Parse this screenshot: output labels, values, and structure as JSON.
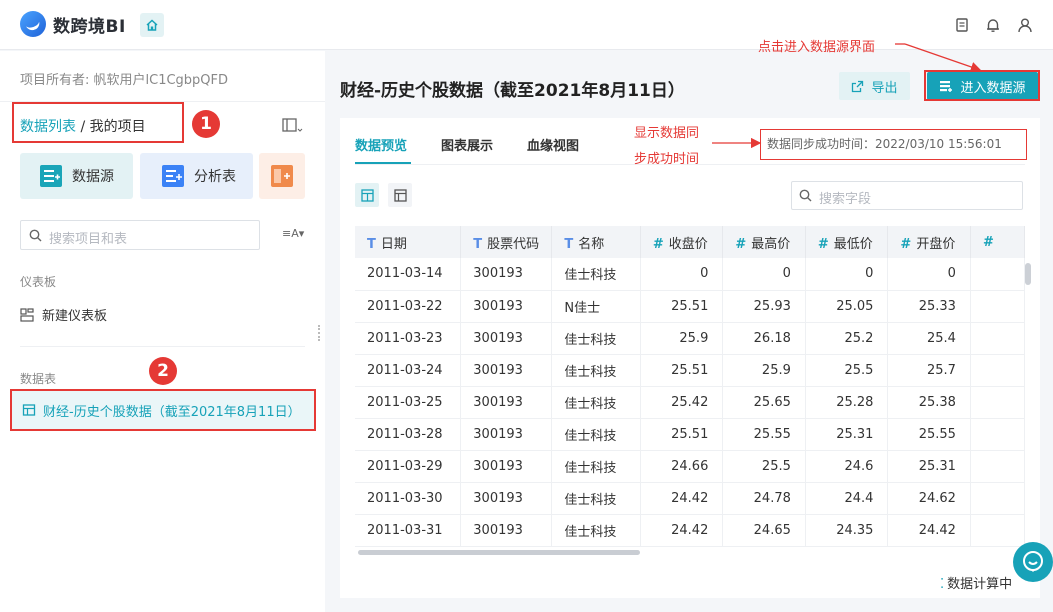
{
  "app": {
    "name": "数跨境BI"
  },
  "sidebar": {
    "owner_label": "项目所有者: 帆软用户lC1CgbpQFD",
    "breadcrumb_link": "数据列表",
    "breadcrumb_sep": " / ",
    "breadcrumb_current": "我的项目",
    "quick_actions": [
      {
        "label": "数据源",
        "icon": "datasource-icon"
      },
      {
        "label": "分析表",
        "icon": "analysis-table-icon"
      }
    ],
    "search_placeholder": "搜索项目和表",
    "dashboard_section": "仪表板",
    "new_dashboard": "新建仪表板",
    "table_section": "数据表",
    "selected_table": "财经-历史个股数据（截至2021年8月11日）"
  },
  "main": {
    "title": "财经-历史个股数据（截至2021年8月11日）",
    "export_label": "导出",
    "enter_label": "进入数据源",
    "tabs": [
      {
        "label": "数据预览",
        "active": true
      },
      {
        "label": "图表展示",
        "active": false
      },
      {
        "label": "血缘视图",
        "active": false
      }
    ],
    "sync_text": "数据同步成功时间：2022/03/10 15:56:01",
    "field_search_placeholder": "搜索字段",
    "computing_label": "数据计算中"
  },
  "table": {
    "columns": [
      {
        "type": "T",
        "label": "日期"
      },
      {
        "type": "T",
        "label": "股票代码"
      },
      {
        "type": "T",
        "label": "名称"
      },
      {
        "type": "#",
        "label": "收盘价"
      },
      {
        "type": "#",
        "label": "最高价"
      },
      {
        "type": "#",
        "label": "最低价"
      },
      {
        "type": "#",
        "label": "开盘价"
      },
      {
        "type": "#",
        "label": ""
      }
    ],
    "rows": [
      [
        "2011-03-14",
        "300193",
        "佳士科技",
        "0",
        "0",
        "0",
        "0"
      ],
      [
        "2011-03-22",
        "300193",
        "N佳士",
        "25.51",
        "25.93",
        "25.05",
        "25.33"
      ],
      [
        "2011-03-23",
        "300193",
        "佳士科技",
        "25.9",
        "26.18",
        "25.2",
        "25.4"
      ],
      [
        "2011-03-24",
        "300193",
        "佳士科技",
        "25.51",
        "25.9",
        "25.5",
        "25.7"
      ],
      [
        "2011-03-25",
        "300193",
        "佳士科技",
        "25.42",
        "25.65",
        "25.28",
        "25.38"
      ],
      [
        "2011-03-28",
        "300193",
        "佳士科技",
        "25.51",
        "25.55",
        "25.31",
        "25.55"
      ],
      [
        "2011-03-29",
        "300193",
        "佳士科技",
        "24.66",
        "25.5",
        "24.6",
        "25.31"
      ],
      [
        "2011-03-30",
        "300193",
        "佳士科技",
        "24.42",
        "24.78",
        "24.4",
        "24.62"
      ],
      [
        "2011-03-31",
        "300193",
        "佳士科技",
        "24.42",
        "24.65",
        "24.35",
        "24.42"
      ]
    ]
  },
  "annotations": {
    "enter_hint": "点击进入数据源界面",
    "sync_hint_line1": "显示数据同",
    "sync_hint_line2": "步成功时间",
    "badge1": "1",
    "badge2": "2"
  },
  "colors": {
    "accent": "#17a2b8",
    "annotation": "#e53935"
  }
}
